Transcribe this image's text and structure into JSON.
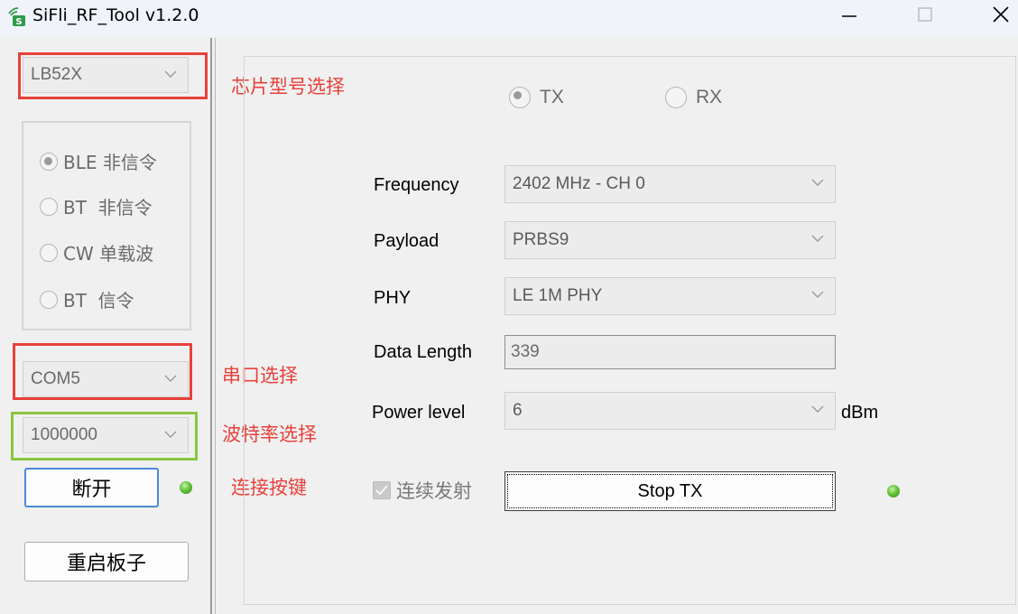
{
  "window": {
    "title": "SiFli_RF_Tool v1.2.0"
  },
  "left": {
    "chip_select": {
      "value": "LB52X",
      "annotation": "芯片型号选择"
    },
    "mode_options": [
      {
        "label": "BLE 非信令",
        "checked": true
      },
      {
        "label": "BT  非信令",
        "checked": false
      },
      {
        "label": "CW 单载波",
        "checked": false
      },
      {
        "label": "BT  信令",
        "checked": false
      }
    ],
    "com_select": {
      "value": "COM5",
      "annotation": "串口选择"
    },
    "baud_select": {
      "value": "1000000",
      "annotation": "波特率选择"
    },
    "connect_button": {
      "label": "断开",
      "annotation": "连接按键"
    },
    "reboot_button": {
      "label": "重启板子"
    }
  },
  "right": {
    "tx_radio": {
      "label": "TX",
      "checked": true
    },
    "rx_radio": {
      "label": "RX",
      "checked": false
    },
    "fields": {
      "frequency": {
        "label": "Frequency",
        "value": "2402 MHz - CH 0"
      },
      "payload": {
        "label": "Payload",
        "value": "PRBS9"
      },
      "phy": {
        "label": "PHY",
        "value": "LE 1M PHY"
      },
      "data_length": {
        "label": "Data Length",
        "value": "339"
      },
      "power_level": {
        "label": "Power level",
        "value": "6",
        "unit": "dBm"
      }
    },
    "continuous": {
      "label": "连续发射",
      "checked": true
    },
    "stop_button": {
      "label": "Stop TX"
    }
  },
  "colors": {
    "annotation_red": "#e8413b",
    "annotation_green": "#8cc63f",
    "led_green": "#64c23a"
  }
}
